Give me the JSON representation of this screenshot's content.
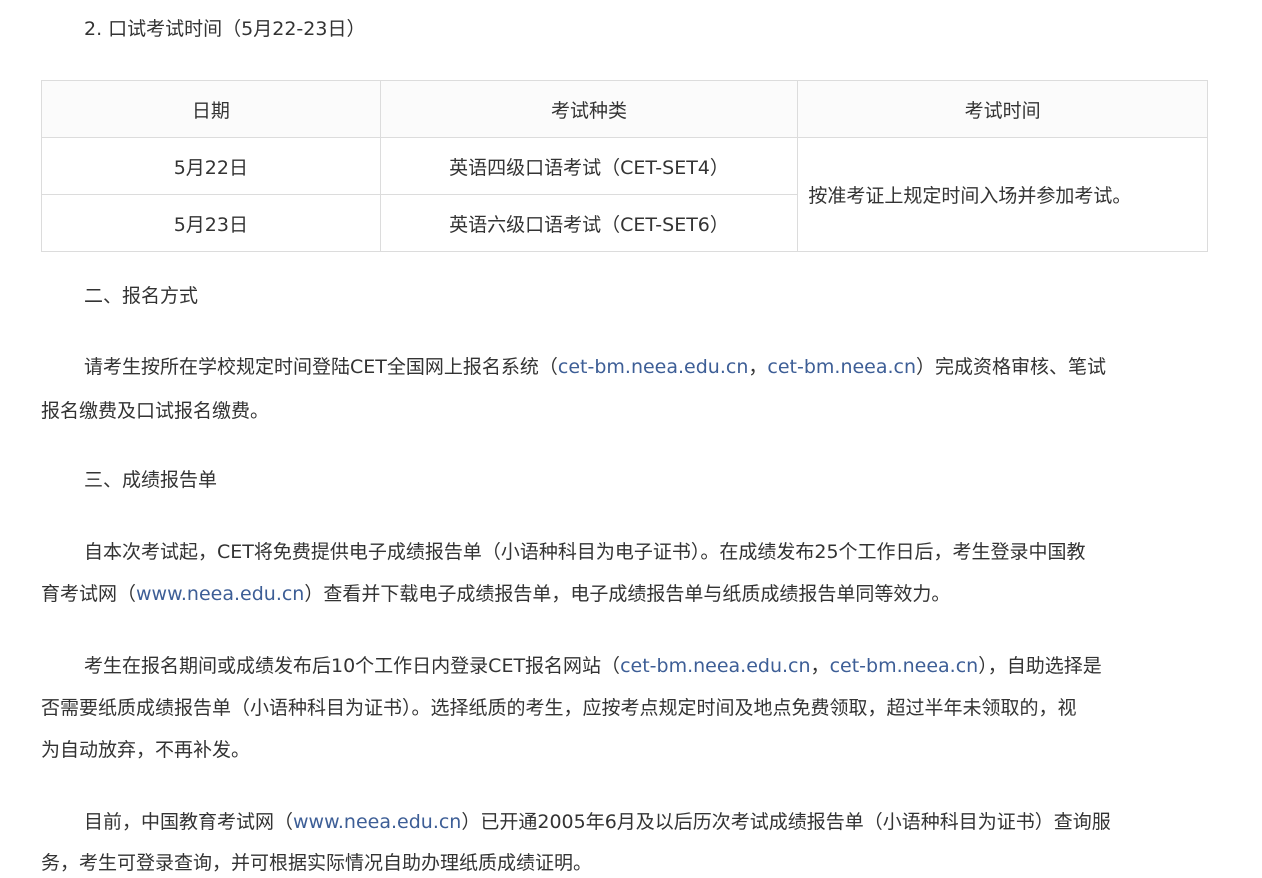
{
  "section_title": "2. 口试考试时间（5月22-23日）",
  "table": {
    "headers": [
      "日期",
      "考试种类",
      "考试时间"
    ],
    "rows": [
      {
        "date": "5月22日",
        "type": "英语四级口语考试（CET-SET4）"
      },
      {
        "date": "5月23日",
        "type": "英语六级口语考试（CET-SET6）"
      }
    ],
    "time_note": "按准考证上规定时间入场并参加考试。"
  },
  "sec2": {
    "heading": "二、报名方式",
    "p1a": "请考生按所在学校规定时间登陆CET全国网上报名系统（",
    "link1": "cet-bm.neea.edu.cn",
    "sep1": "，",
    "link2": "cet-bm.neea.cn",
    "p1b": "）完成资格审核、笔试",
    "p1c": "报名缴费及口试报名缴费。"
  },
  "sec3": {
    "heading": "三、成绩报告单",
    "p1a": "自本次考试起，CET将免费提供电子成绩报告单（小语种科目为电子证书）。在成绩发布25个工作日后，考生登录中国教",
    "p1b": "育考试网（",
    "link1": "www.neea.edu.cn",
    "p1c": "）查看并下载电子成绩报告单，电子成绩报告单与纸质成绩报告单同等效力。",
    "p2a": "考生在报名期间或成绩发布后10个工作日内登录CET报名网站（",
    "link2": "cet-bm.neea.edu.cn",
    "sep2": "，",
    "link3": "cet-bm.neea.cn",
    "p2b": "），自助选择是",
    "p2c": "否需要纸质成绩报告单（小语种科目为证书）。选择纸质的考生，应按考点规定时间及地点免费领取，超过半年未领取的，视",
    "p2d": "为自动放弃，不再补发。",
    "p3a": "目前，中国教育考试网（",
    "link4": "www.neea.edu.cn",
    "p3b": "）已开通2005年6月及以后历次考试成绩报告单（小语种科目为证书）查询服",
    "p3c": "务，考生可登录查询，并可根据实际情况自助办理纸质成绩证明。"
  }
}
